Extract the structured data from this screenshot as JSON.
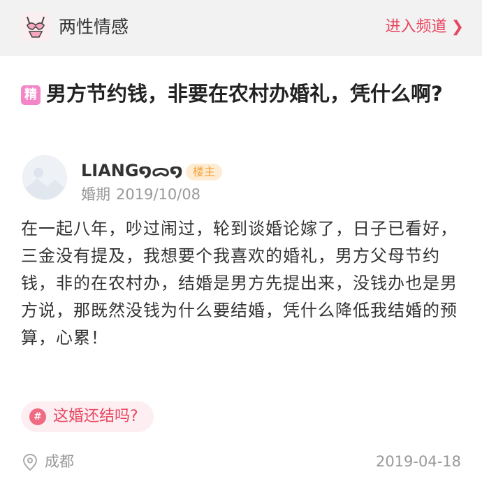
{
  "channel": {
    "name": "两性情感",
    "enter_label": "进入频道",
    "logo_icon": "lingerie-icon",
    "accent_color": "#e8455f"
  },
  "post": {
    "badge": "精",
    "title": "男方节约钱，非要在农村办婚礼，凭什么啊?",
    "author": "LIANG໑ᯅ໑",
    "author_role": "楼主",
    "meta_label": "婚期",
    "meta_date": "2019/10/08",
    "body": "在一起八年，吵过闹过，轮到谈婚论嫁了，日子已看好，三金没有提及，我想要个我喜欢的婚礼，男方父母节约钱，非的在农村办，结婚是男方先提出来，没钱办也是男方说，那既然没钱为什么要结婚，凭什么降低我结婚的预算，心累！",
    "tag": "这婚还结吗?",
    "location": "成都",
    "date": "2019-04-18"
  }
}
